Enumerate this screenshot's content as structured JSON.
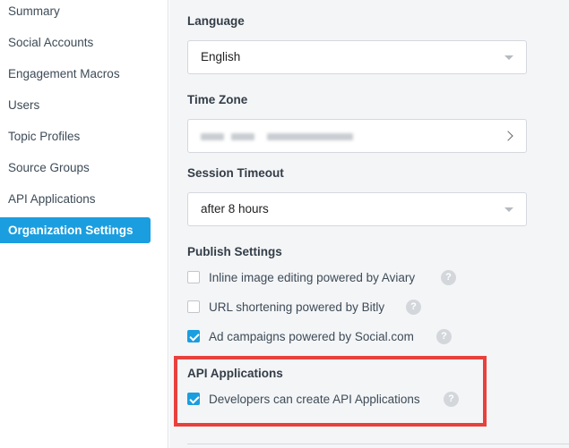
{
  "sidebar": {
    "items": [
      {
        "label": "Summary"
      },
      {
        "label": "Social Accounts"
      },
      {
        "label": "Engagement Macros"
      },
      {
        "label": "Users"
      },
      {
        "label": "Topic Profiles"
      },
      {
        "label": "Source Groups"
      },
      {
        "label": "API Applications"
      },
      {
        "label": "Organization Settings",
        "active": true
      }
    ]
  },
  "settings": {
    "language": {
      "label": "Language",
      "value": "English",
      "icon": "chevron-down-icon"
    },
    "time_zone": {
      "label": "Time Zone",
      "value_redacted": true,
      "icon": "chevron-right-icon"
    },
    "session_timeout": {
      "label": "Session Timeout",
      "value": "after 8 hours",
      "icon": "chevron-down-icon"
    },
    "publish_settings": {
      "label": "Publish Settings",
      "options": [
        {
          "label": "Inline image editing powered by Aviary",
          "checked": false
        },
        {
          "label": "URL shortening powered by Bitly",
          "checked": false
        },
        {
          "label": "Ad campaigns powered by Social.com",
          "checked": true
        }
      ]
    },
    "api_applications": {
      "label": "API Applications",
      "options": [
        {
          "label": "Developers can create API Applications",
          "checked": true
        }
      ]
    },
    "help_glyph": "?"
  },
  "colors": {
    "accent": "#1a9ee0",
    "highlight": "#e8413d",
    "background": "#f4f5f7"
  }
}
